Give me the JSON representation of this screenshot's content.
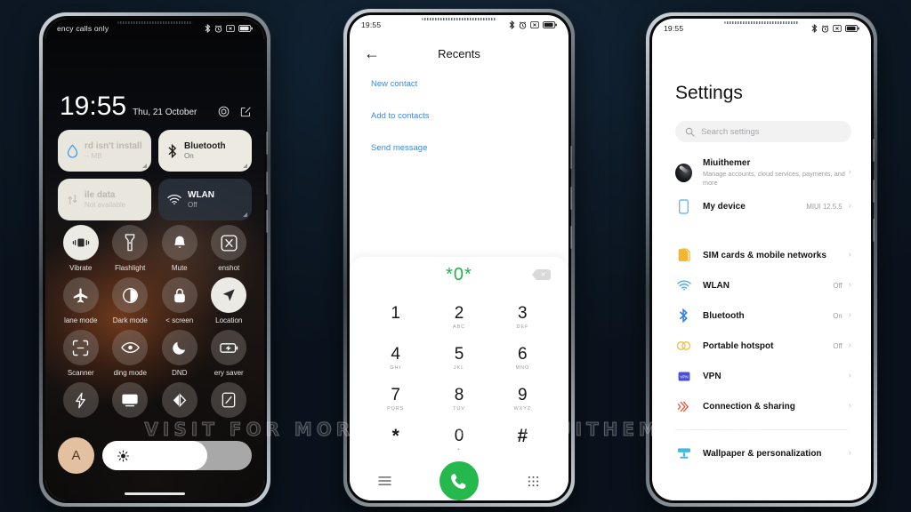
{
  "watermark": "VISIT FOR MORE THEMES - MIUITHEMER.COM",
  "colors": {
    "accent_green": "#25b94d",
    "link_blue": "#3f87e0",
    "wifi_blue": "#3ea9e8",
    "bt_blue": "#2f7ff0",
    "sim_yellow": "#f2b632",
    "hotspot_yellow": "#f5c33f",
    "vpn_indigo": "#4a4fd8",
    "sharing_red": "#e4533a",
    "wall_teal": "#49b6e0",
    "background": "#0d1822"
  },
  "phone1": {
    "statusbar": {
      "carrier": "ency calls only",
      "icons": [
        "bluetooth-icon",
        "alarm-icon",
        "screenshot-icon",
        "battery-icon"
      ]
    },
    "clock": {
      "time": "19:55",
      "date": "Thu, 21 October"
    },
    "clock_actions": [
      "settings-gear-icon",
      "edit-icon"
    ],
    "tiles": [
      {
        "title": "rd isn't install",
        "subtitle": "-- MB",
        "style": "dim-faded",
        "icon": "water-drop-icon"
      },
      {
        "title": "Bluetooth",
        "subtitle": "On",
        "style": "on",
        "icon": "bluetooth-icon"
      },
      {
        "title": "ile data",
        "subtitle": "Not available",
        "style": "dim-faded",
        "icon": "mobile-data-icon"
      },
      {
        "title": "WLAN",
        "subtitle": "Off",
        "style": "dark",
        "icon": "wifi-icon"
      }
    ],
    "toggles": [
      {
        "label": "Vibrate",
        "icon": "vibrate-icon",
        "active": true
      },
      {
        "label": "Flashlight",
        "icon": "flashlight-icon",
        "active": false
      },
      {
        "label": "Mute",
        "icon": "bell-icon",
        "active": false
      },
      {
        "label": "enshot",
        "icon": "screenshot-icon",
        "active": false
      },
      {
        "label": "lane mode",
        "icon": "airplane-icon",
        "active": false
      },
      {
        "label": "Dark mode",
        "icon": "contrast-icon",
        "active": false
      },
      {
        "label": "< screen",
        "icon": "lock-icon",
        "active": false
      },
      {
        "label": "Location",
        "icon": "location-arrow-icon",
        "active": true
      },
      {
        "label": "Scanner",
        "icon": "scan-frame-icon",
        "active": false
      },
      {
        "label": "ding mode",
        "icon": "eye-icon",
        "active": false
      },
      {
        "label": "DND",
        "icon": "moon-icon",
        "active": false
      },
      {
        "label": "ery saver",
        "icon": "battery-saver-icon",
        "active": false
      },
      {
        "label": "",
        "icon": "lightning-icon",
        "active": false
      },
      {
        "label": "",
        "icon": "cast-icon",
        "active": false
      },
      {
        "label": "",
        "icon": "ultra-battery-icon",
        "active": false
      },
      {
        "label": "",
        "icon": "screen-rotate-icon",
        "active": false
      }
    ],
    "brightness": {
      "auto_label": "A",
      "level_percent": 70,
      "icon": "brightness-sun-icon"
    }
  },
  "phone2": {
    "statusbar": {
      "time": "19:55"
    },
    "header": {
      "back": "back-arrow-icon",
      "title": "Recents"
    },
    "links": [
      "New contact",
      "Add to contacts",
      "Send message"
    ],
    "dialer": {
      "number": "*0*",
      "delete_icon": "backspace-icon",
      "keys": [
        {
          "digit": "1",
          "letters": ""
        },
        {
          "digit": "2",
          "letters": "ABC"
        },
        {
          "digit": "3",
          "letters": "DEF"
        },
        {
          "digit": "4",
          "letters": "GHI"
        },
        {
          "digit": "5",
          "letters": "JKL"
        },
        {
          "digit": "6",
          "letters": "MNO"
        },
        {
          "digit": "7",
          "letters": "PQRS"
        },
        {
          "digit": "8",
          "letters": "TUV"
        },
        {
          "digit": "9",
          "letters": "WXYZ"
        },
        {
          "digit": "*",
          "letters": ""
        },
        {
          "digit": "0",
          "letters": "+"
        },
        {
          "digit": "#",
          "letters": ""
        }
      ],
      "bottom": [
        "menu-icon",
        "call-button",
        "keypad-icon"
      ]
    }
  },
  "phone3": {
    "statusbar": {
      "time": "19:55"
    },
    "title": "Settings",
    "search": {
      "placeholder": "Search settings",
      "icon": "search-icon"
    },
    "account": {
      "name": "Miuithemer",
      "subtitle": "Manage accounts, cloud services, payments, and more"
    },
    "rows": [
      {
        "label": "My device",
        "value": "MIUI 12.5.5",
        "icon": "device-icon"
      },
      {
        "label": "SIM cards & mobile networks",
        "value": "",
        "icon": "sim-icon"
      },
      {
        "label": "WLAN",
        "value": "Off",
        "icon": "wifi-icon"
      },
      {
        "label": "Bluetooth",
        "value": "On",
        "icon": "bluetooth-icon"
      },
      {
        "label": "Portable hotspot",
        "value": "Off",
        "icon": "hotspot-icon"
      },
      {
        "label": "VPN",
        "value": "",
        "icon": "vpn-icon"
      },
      {
        "label": "Connection & sharing",
        "value": "",
        "icon": "sharing-icon"
      },
      {
        "label": "Wallpaper & personalization",
        "value": "",
        "icon": "wallpaper-icon"
      }
    ]
  }
}
